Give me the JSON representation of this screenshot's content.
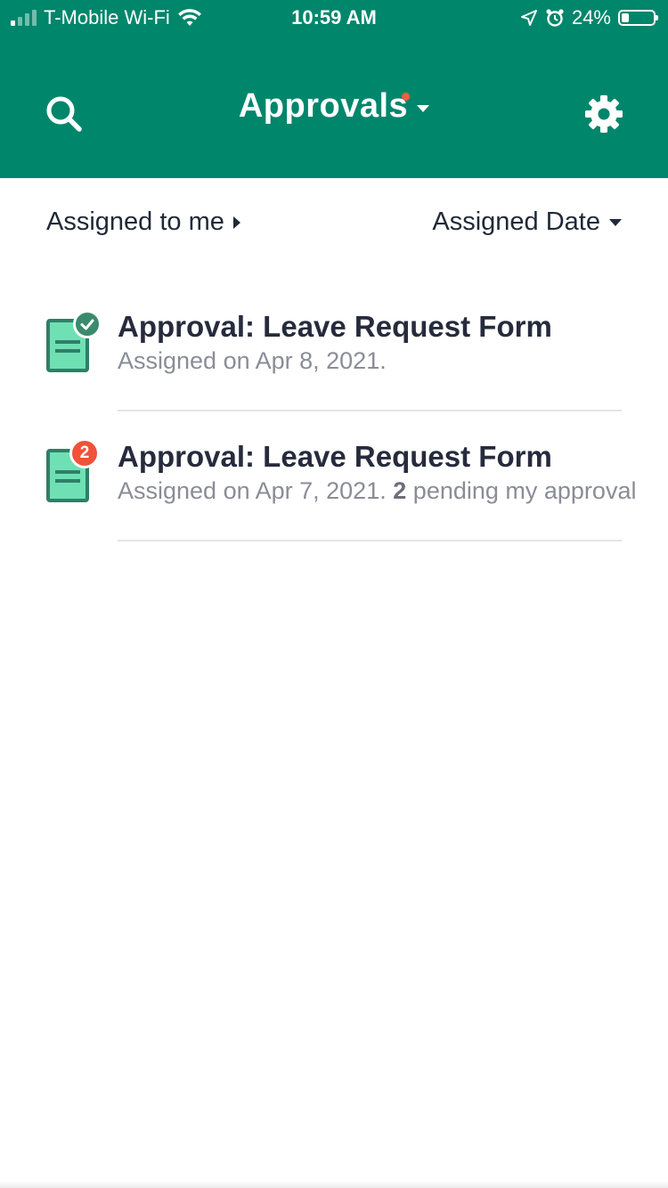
{
  "status_bar": {
    "carrier": "T-Mobile Wi-Fi",
    "time": "10:59 AM",
    "battery": "24%",
    "battery_level": 0.24,
    "icons": [
      "signal-icon",
      "wifi-icon",
      "location-icon",
      "alarm-icon",
      "battery-icon"
    ]
  },
  "header": {
    "title": "Approvals",
    "background": "#00866b",
    "notification_dot_color": "#ff5a3c",
    "icons": [
      "search-icon",
      "chevron-down-icon",
      "gear-icon"
    ]
  },
  "filters": {
    "scope_label": "Assigned to me",
    "sort_label": "Assigned Date"
  },
  "list": {
    "items": [
      {
        "title": "Approval: Leave Request Form",
        "subtitle": "Assigned on Apr 8, 2021.",
        "status": "approved",
        "icon": "document-icon"
      },
      {
        "title": "Approval: Leave Request Form",
        "subtitle": "Assigned on Apr 7, 2021.",
        "pending_count": "2",
        "pending_text": "pending my approval",
        "badge_count": "2",
        "icon": "document-icon"
      }
    ]
  },
  "colors": {
    "accent_green": "#00866b",
    "doc_fill": "#6fe0b4",
    "doc_stroke": "#2f7f68",
    "badge_red": "#f0533a",
    "check_green": "#3a8a6e"
  }
}
